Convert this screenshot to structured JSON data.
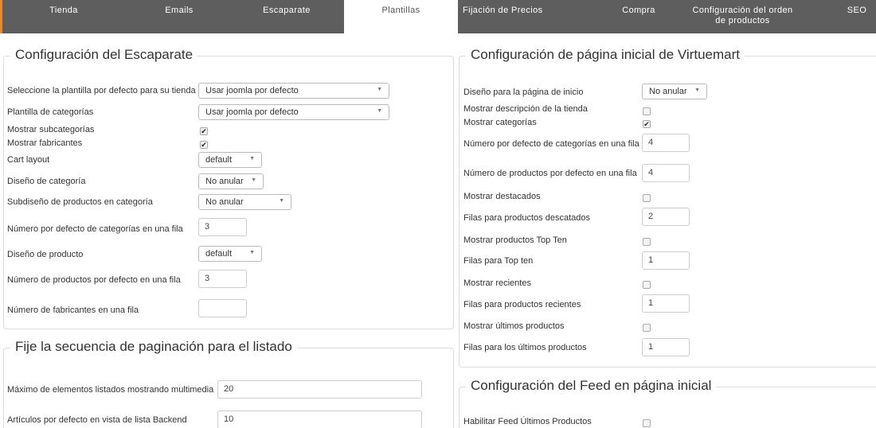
{
  "tabs": [
    {
      "label": "Tienda",
      "sub": ""
    },
    {
      "label": "Emails",
      "sub": ""
    },
    {
      "label": "Escaparate",
      "sub": ""
    },
    {
      "label": "Plantillas",
      "sub": ""
    },
    {
      "label": "Fijación de Precios",
      "sub": ""
    },
    {
      "label": "Compra",
      "sub": ""
    },
    {
      "label": "Configuración del orden",
      "sub": "de productos"
    },
    {
      "label": "SEO",
      "sub": ""
    }
  ],
  "active_tab": "Plantillas",
  "colors": {
    "tabbar": "#5e5e5e",
    "accent": "#e58b2f",
    "active_tab_bg": "#ffffff"
  },
  "escaparate": {
    "legend": "Configuración del Escaparate",
    "template_label": "Seleccione la plantilla por defecto para su tienda",
    "template_value": "Usar joomla por defecto",
    "cat_template_label": "Plantilla de categorías",
    "cat_template_value": "Usar joomla por defecto",
    "show_subcat_label": "Mostrar subcategorías",
    "show_subcat_checked": true,
    "show_manuf_label": "Mostrar fabricantes",
    "show_manuf_checked": true,
    "cart_layout_label": "Cart layout",
    "cart_layout_value": "default",
    "cat_design_label": "Diseño de categoría",
    "cat_design_value": "No anular",
    "subdesign_label": "Subdiseño de productos en categoría",
    "subdesign_value": "No anular",
    "cats_per_row_label": "Número por defecto de categorías en una fila",
    "cats_per_row_value": "3",
    "product_design_label": "Diseño de producto",
    "product_design_value": "default",
    "products_per_row_label": "Número de productos por defecto en una fila",
    "products_per_row_value": "3",
    "manuf_per_row_label": "Número de fabricantes en una fila",
    "manuf_per_row_value": ""
  },
  "paginacion": {
    "legend": "Fije la secuencia de paginación para el listado",
    "max_items_label": "Máximo de elementos listados mostrando multimedia",
    "max_items_value": "20",
    "articles_label": "Artículos por defecto en vista de lista Backend",
    "articles_value": "10"
  },
  "home": {
    "legend": "Configuración de página inicial de Virtuemart",
    "design_label": "Diseño para la página de inicio",
    "design_value": "No anular",
    "show_desc_label": "Mostrar descripción de la tienda",
    "show_desc_checked": false,
    "show_cats_label": "Mostrar categorías",
    "show_cats_checked": true,
    "cats_per_row_label": "Número por defecto de categorías en una fila",
    "cats_per_row_value": "4",
    "products_per_row_label": "Número de productos por defecto en una fila",
    "products_per_row_value": "4",
    "show_featured_label": "Mostrar destacados",
    "show_featured_checked": false,
    "featured_rows_label": "Filas para productos descatados",
    "featured_rows_value": "2",
    "show_topten_label": "Mostrar productos Top Ten",
    "show_topten_checked": false,
    "topten_rows_label": "Filas para Top ten",
    "topten_rows_value": "1",
    "show_recent_label": "Mostrar recientes",
    "show_recent_checked": false,
    "recent_rows_label": "Filas para productos recientes",
    "recent_rows_value": "1",
    "show_latest_label": "Mostrar últimos productos",
    "show_latest_checked": false,
    "latest_rows_label": "Filas para los últimos productos",
    "latest_rows_value": "1"
  },
  "feed": {
    "legend": "Configuración del Feed en página inicial",
    "enable_latest_label": "Habilitar Feed Últimos Productos",
    "enable_latest_checked": false
  }
}
